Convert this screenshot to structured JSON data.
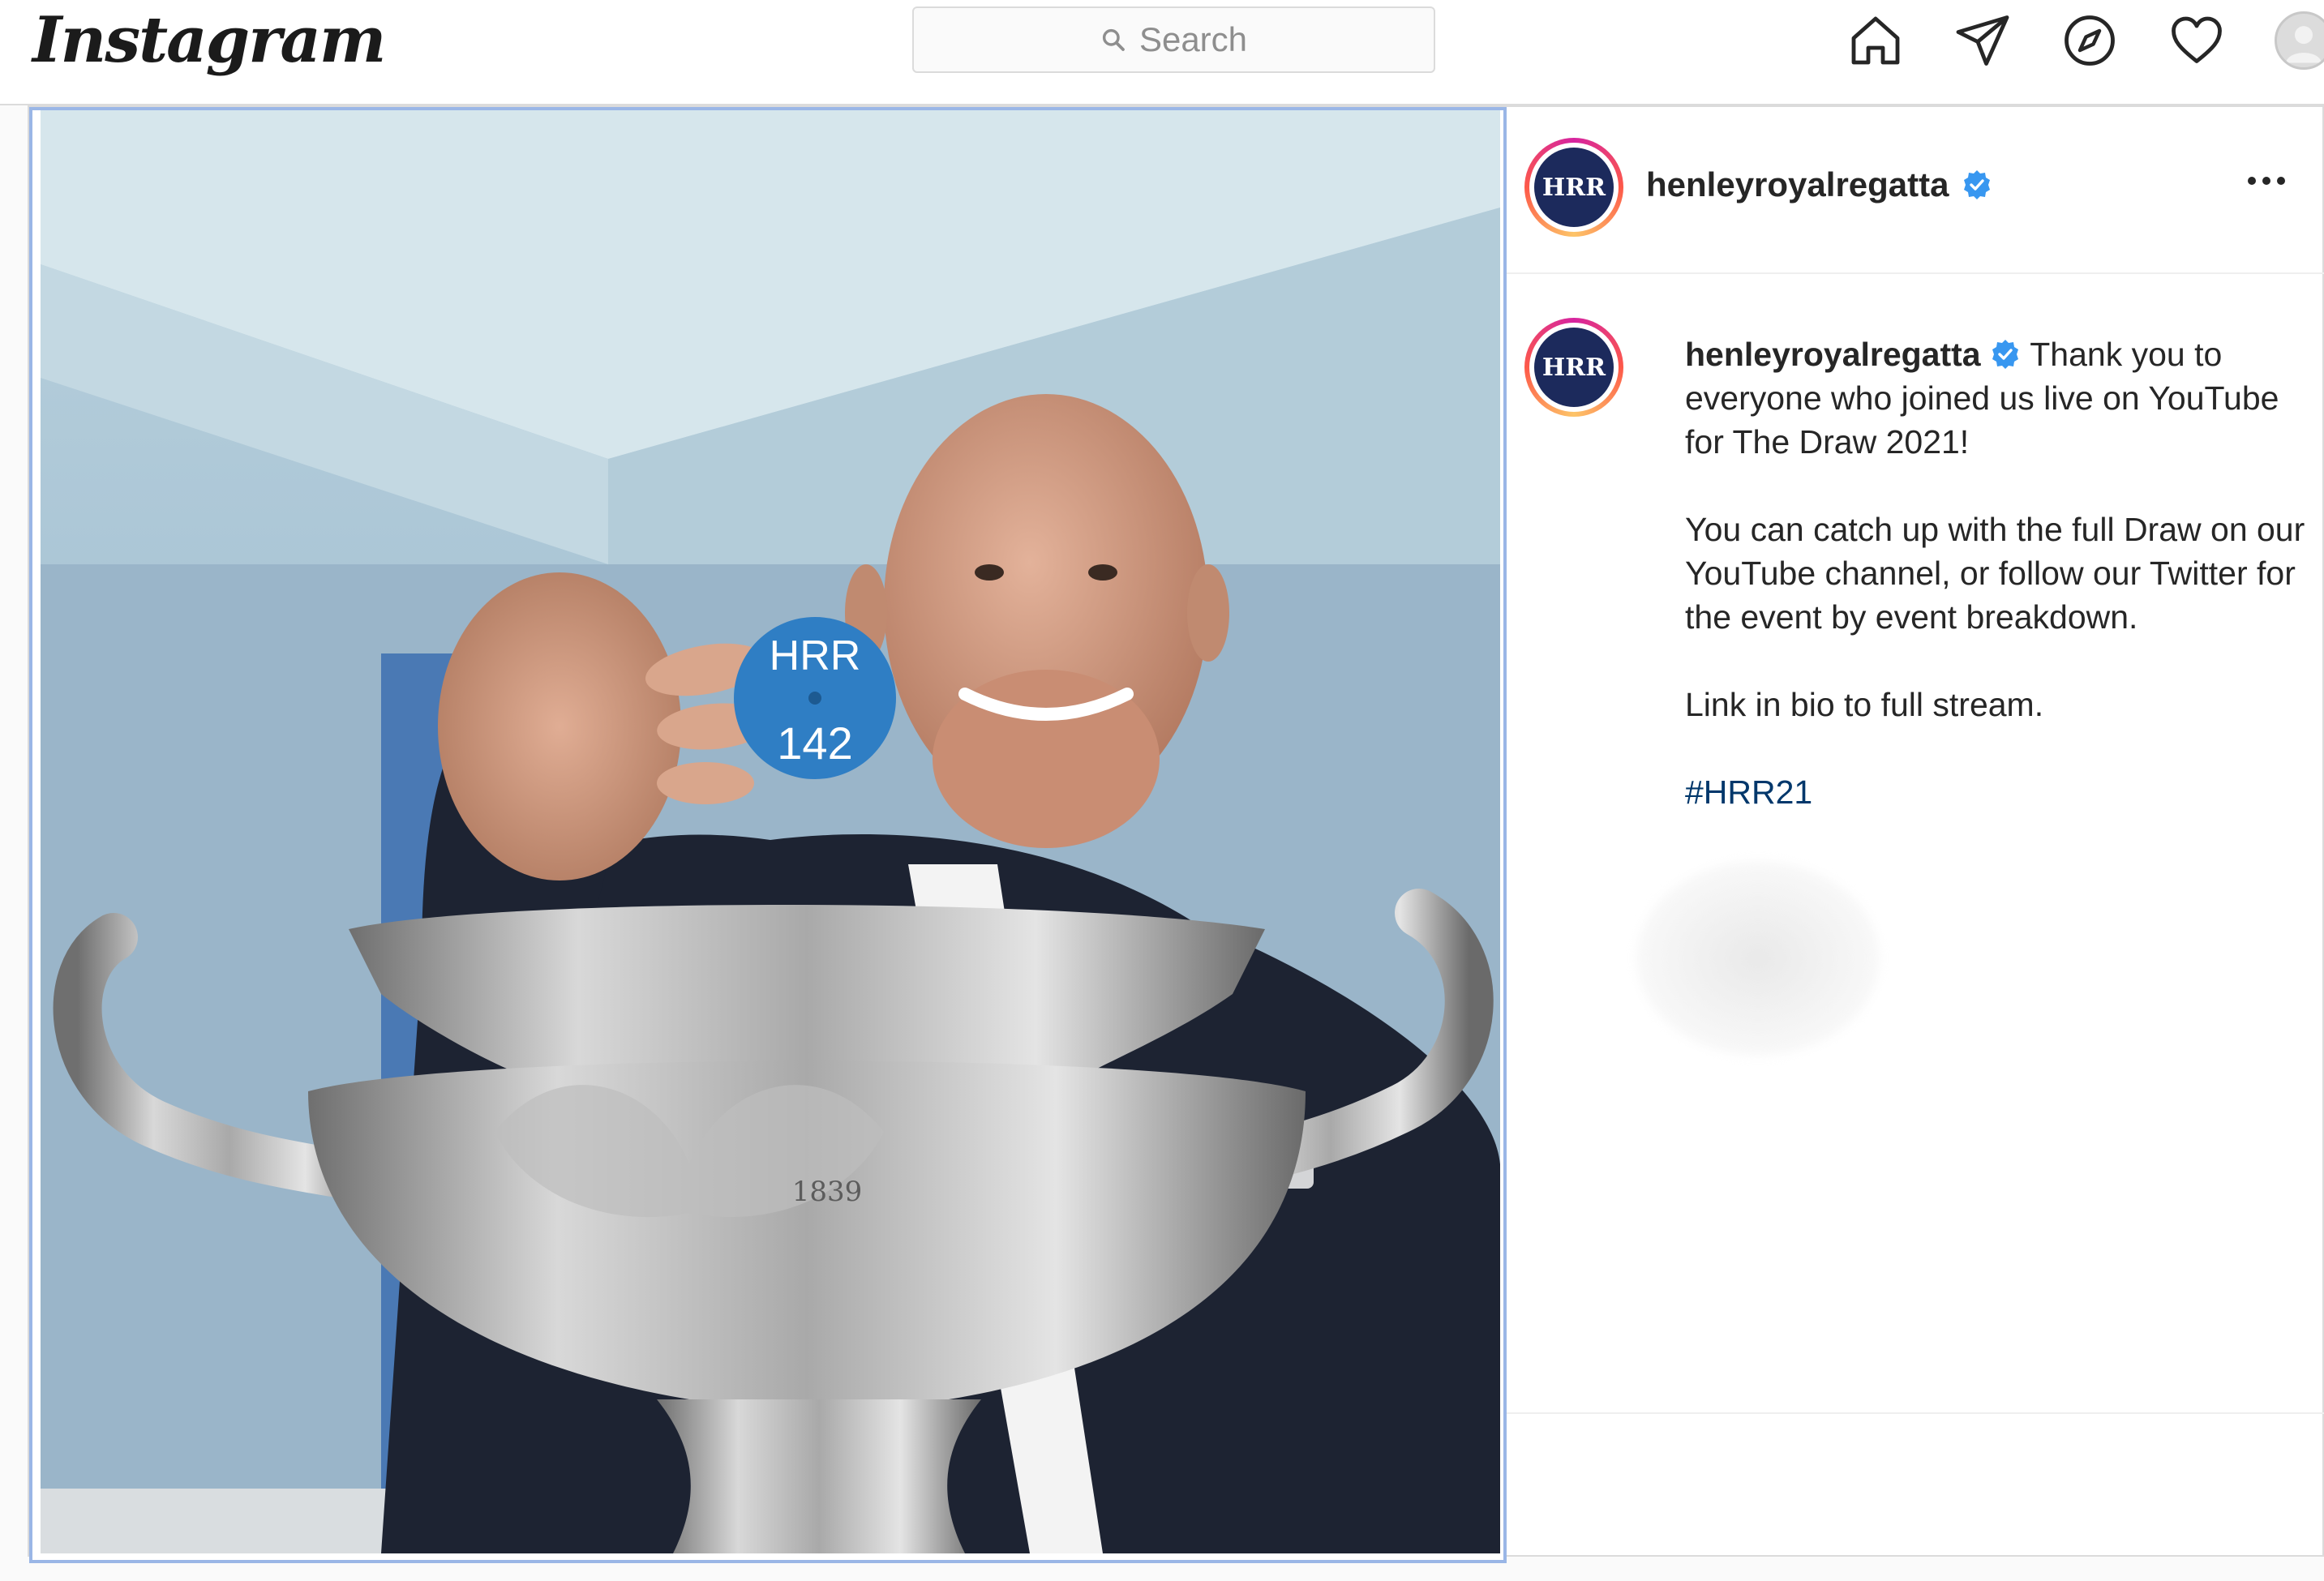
{
  "app": {
    "logo": "Instagram"
  },
  "search": {
    "placeholder": "Search"
  },
  "nav": {
    "icons": [
      "home-icon",
      "direct-message-icon",
      "explore-compass-icon",
      "activity-heart-icon",
      "profile-avatar"
    ]
  },
  "post": {
    "username": "henleyroyalregatta",
    "verified": true,
    "photo": {
      "disc_top_text": "HRR",
      "disc_number": "142",
      "trophy_inscription": "1839"
    },
    "caption": {
      "lead": "Thank you to everyone who joined us live on YouTube for The Draw 2021!",
      "paragraph2": "You can catch up with the full Draw on our YouTube channel, or follow our Twitter for the event by event breakdown.",
      "paragraph3": "Link in bio to full stream.",
      "hashtag": "#HRR21"
    }
  },
  "colors": {
    "accent_blue": "#3897f0",
    "hashtag": "#00376b",
    "crest_navy": "#1c2a5c",
    "frame_highlight": "#9ab6e6"
  }
}
